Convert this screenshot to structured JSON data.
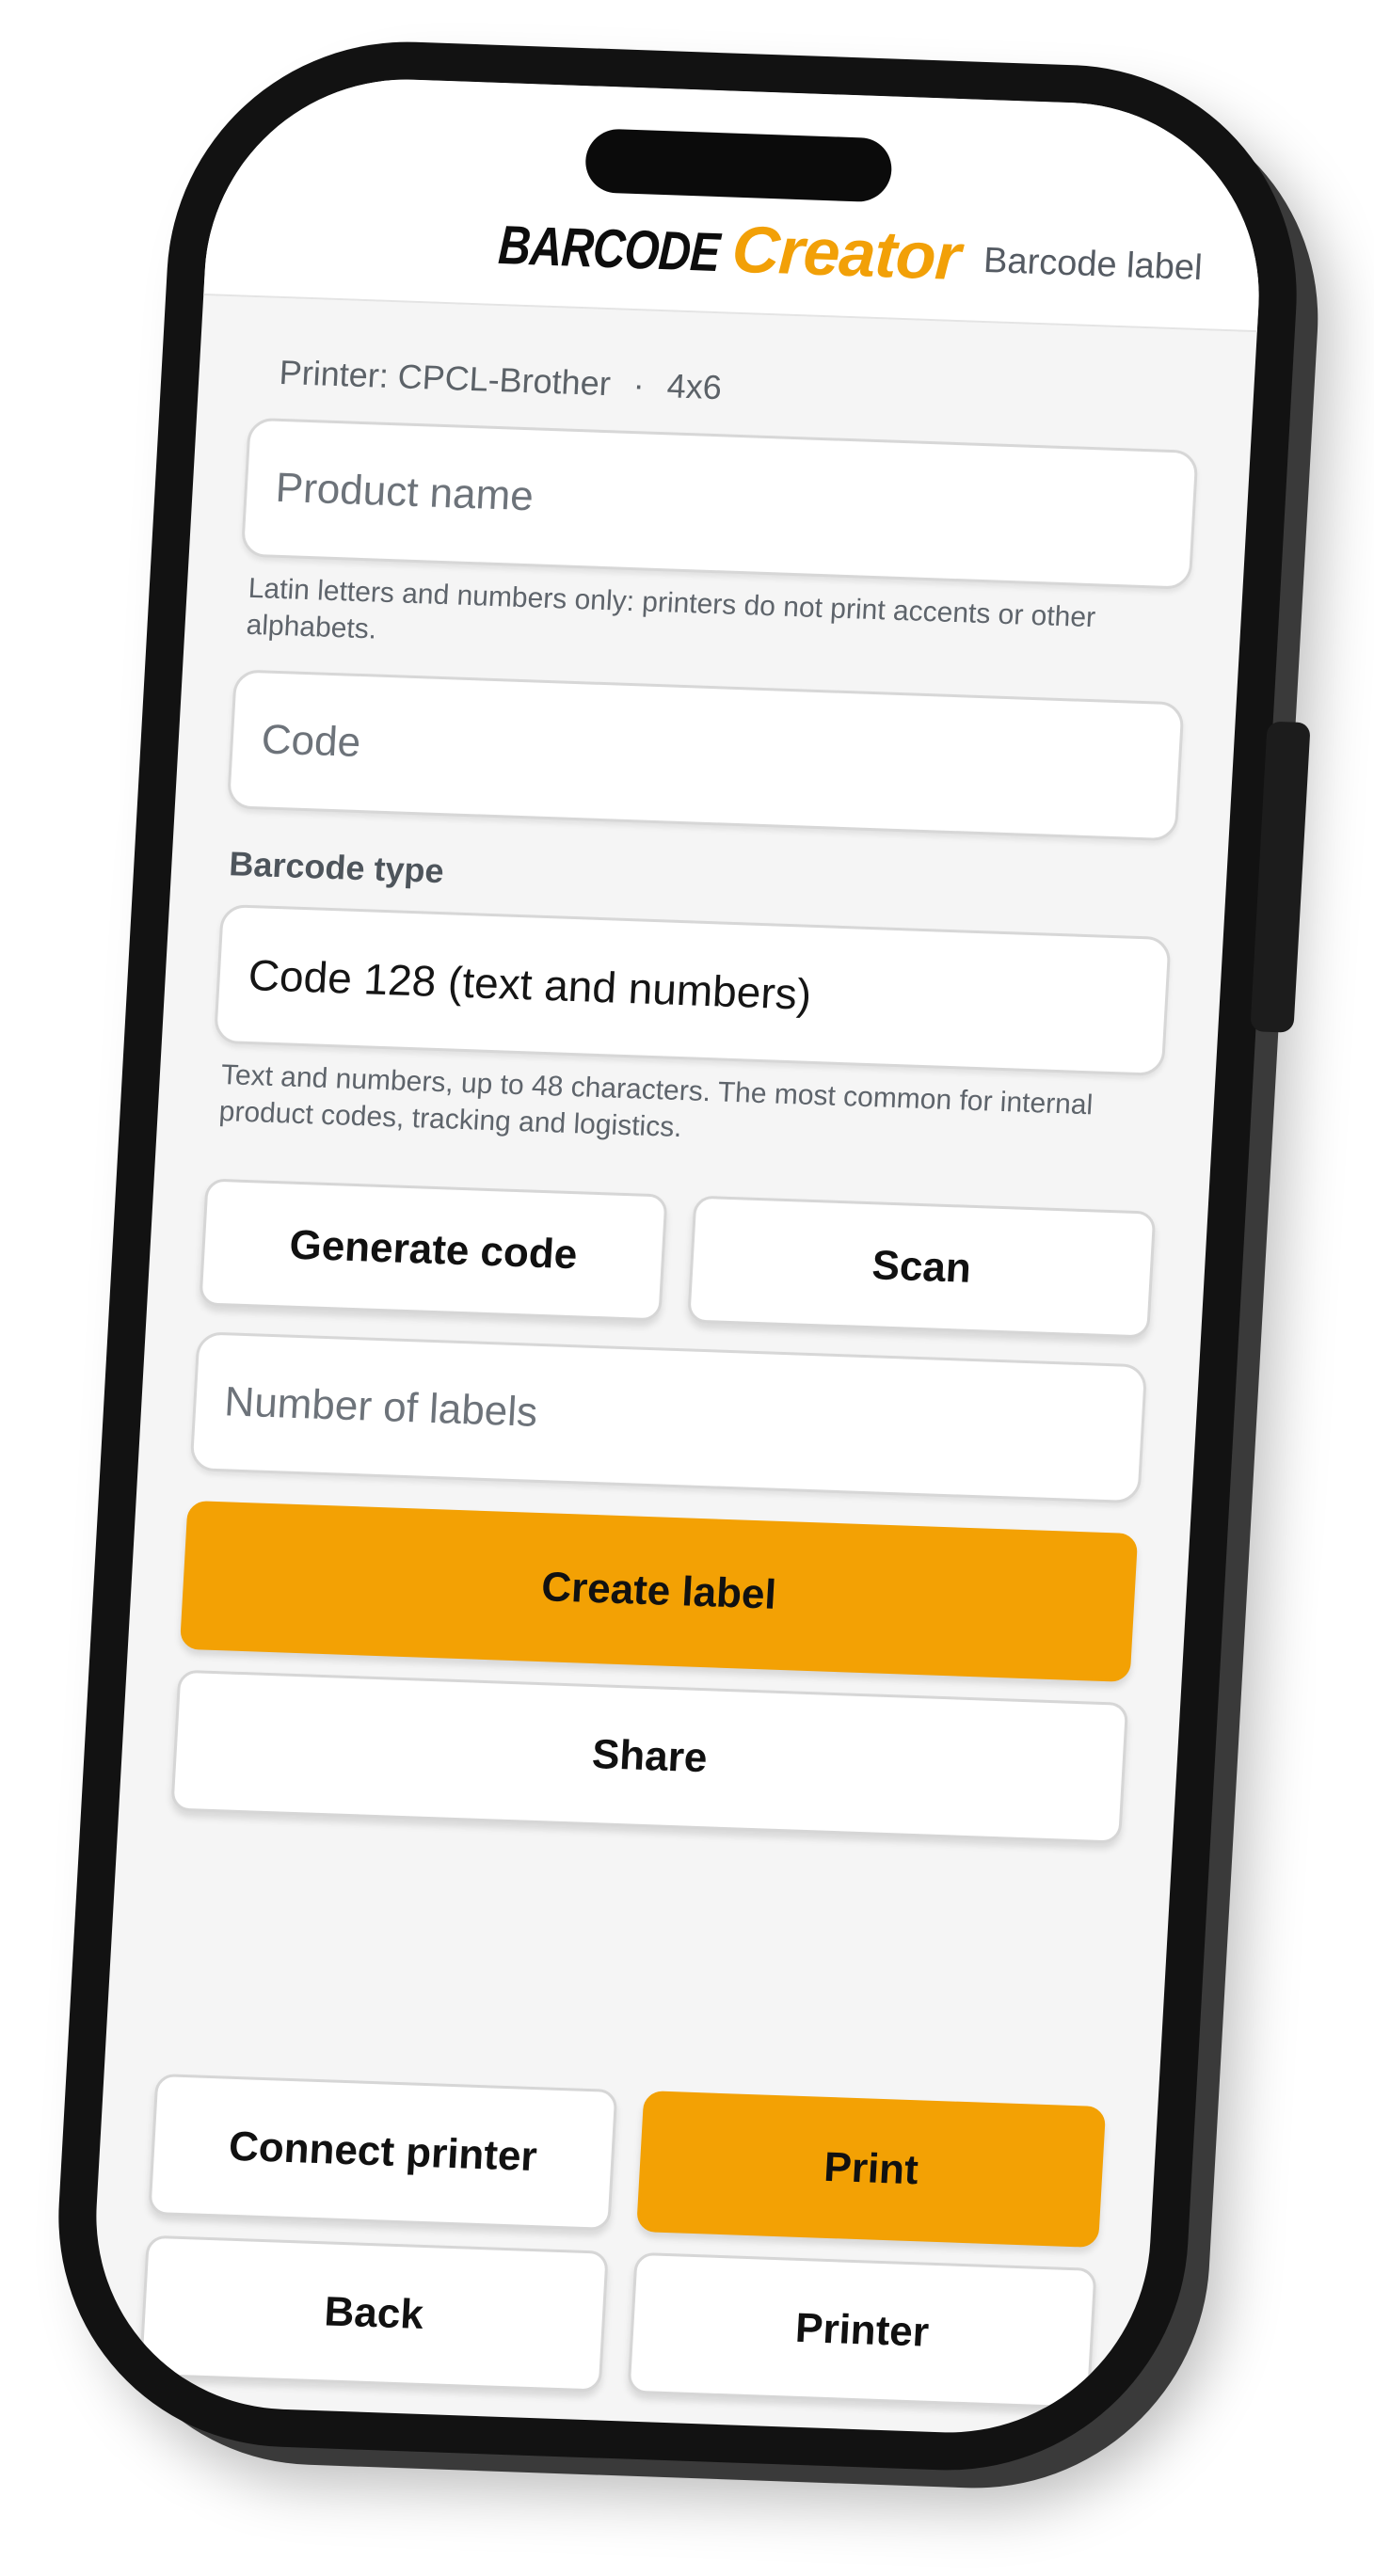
{
  "header": {
    "logo_part1": "BARCODE",
    "logo_part2": "Creator",
    "subtitle": "Barcode label"
  },
  "printer_info": {
    "label": "Printer: CPCL-Brother",
    "separator": "·",
    "size": "4x6"
  },
  "product_name": {
    "placeholder": "Product name",
    "value": "",
    "hint": "Latin letters and numbers only: printers do not print accents or other alphabets."
  },
  "code": {
    "placeholder": "Code",
    "value": ""
  },
  "barcode_type": {
    "label": "Barcode type",
    "selected": "Code 128 (text and numbers)",
    "hint": "Text and numbers, up to 48 characters. The most common for internal product codes, tracking and logistics."
  },
  "actions": {
    "generate_code": "Generate code",
    "scan": "Scan"
  },
  "number_of_labels": {
    "placeholder": "Number of labels",
    "value": ""
  },
  "create_label": "Create label",
  "share": "Share",
  "bottom": {
    "connect_printer": "Connect printer",
    "print": "Print",
    "back": "Back",
    "printer": "Printer"
  },
  "colors": {
    "accent": "#F3A104",
    "background": "#F5F5F5",
    "text": "#111111"
  }
}
